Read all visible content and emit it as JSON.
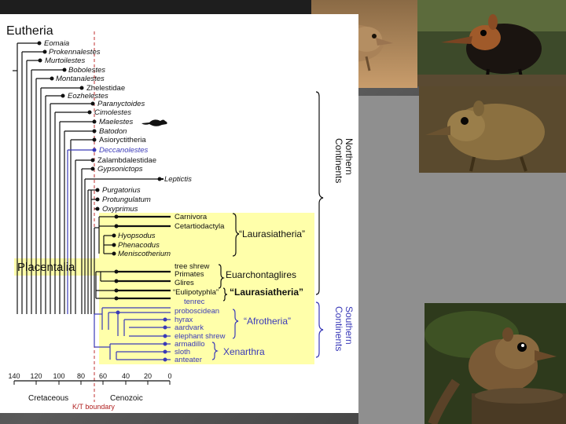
{
  "title": "Eutheria",
  "taxa": {
    "eomaia": "Eomaia",
    "prokennalestes": "Prokennalestes",
    "murtoilestes": "Murtoilestes",
    "bobolestes": "Bobolestes",
    "montanalestes": "Montanalestes",
    "zhelestidae": "Zhelestidae",
    "eozhelestes": "Eozhelestes",
    "paranyctoides": "Paranyctoides",
    "cimolestes": "Cimolestes",
    "maelestes": "Maelestes",
    "batodon": "Batodon",
    "asioryctitheria": "Asioryctitheria",
    "deccanolestes": "Deccanolestes",
    "zalambdalestidae": "Zalambdalestidae",
    "gypsonictops": "Gypsonictops",
    "leptictis": "Leptictis",
    "purgatorius": "Purgatorius",
    "protungulatum": "Protungulatum",
    "oxyprimus": "Oxyprimus",
    "carnivora": "Carnivora",
    "cetartiodactyla": "Cetartiodactyla",
    "hyopsodus": "Hyopsodus",
    "phenacodus": "Phenacodus",
    "meniscotherium": "Meniscotherium",
    "tree_shrew": "tree shrew",
    "primates": "Primates",
    "glires": "Glires",
    "eulipotyphla": "“Eulipotyphla”",
    "tenrec": "tenrec",
    "proboscidean": "proboscidean",
    "hyrax": "hyrax",
    "aardvark": "aardvark",
    "elephant_shrew": "elephant shrew",
    "armadillo": "armadillo",
    "sloth": "sloth",
    "anteater": "anteater"
  },
  "groups": {
    "laurasiatheria_1": "“Laurasiatheria”",
    "euarchontaglires": "Euarchontaglires",
    "laurasiatheria_2": "“Laurasiatheria”",
    "afrotheria": "“Afrotheria”",
    "xenarthra": "Xenarthra",
    "placentalia": "Placentalia"
  },
  "side_labels": {
    "northern": "Northern\nContinents",
    "southern": "Southern\nContinents"
  },
  "axis": {
    "ticks": [
      "140",
      "120",
      "100",
      "80",
      "60",
      "40",
      "20",
      "0"
    ],
    "cretaceous": "Cretaceous",
    "cenozoic": "Cenozoic",
    "kt_boundary": "K/T boundary"
  },
  "colors": {
    "southern_blue": "#3a3ab8",
    "placental_yellow": "#ffffaa",
    "kt_red": "#c03030"
  },
  "photos": [
    "elephant-shrew-photo-1",
    "elephant-shrew-photo-2",
    "elephant-shrew-photo-3",
    "treeshrew-photo"
  ]
}
